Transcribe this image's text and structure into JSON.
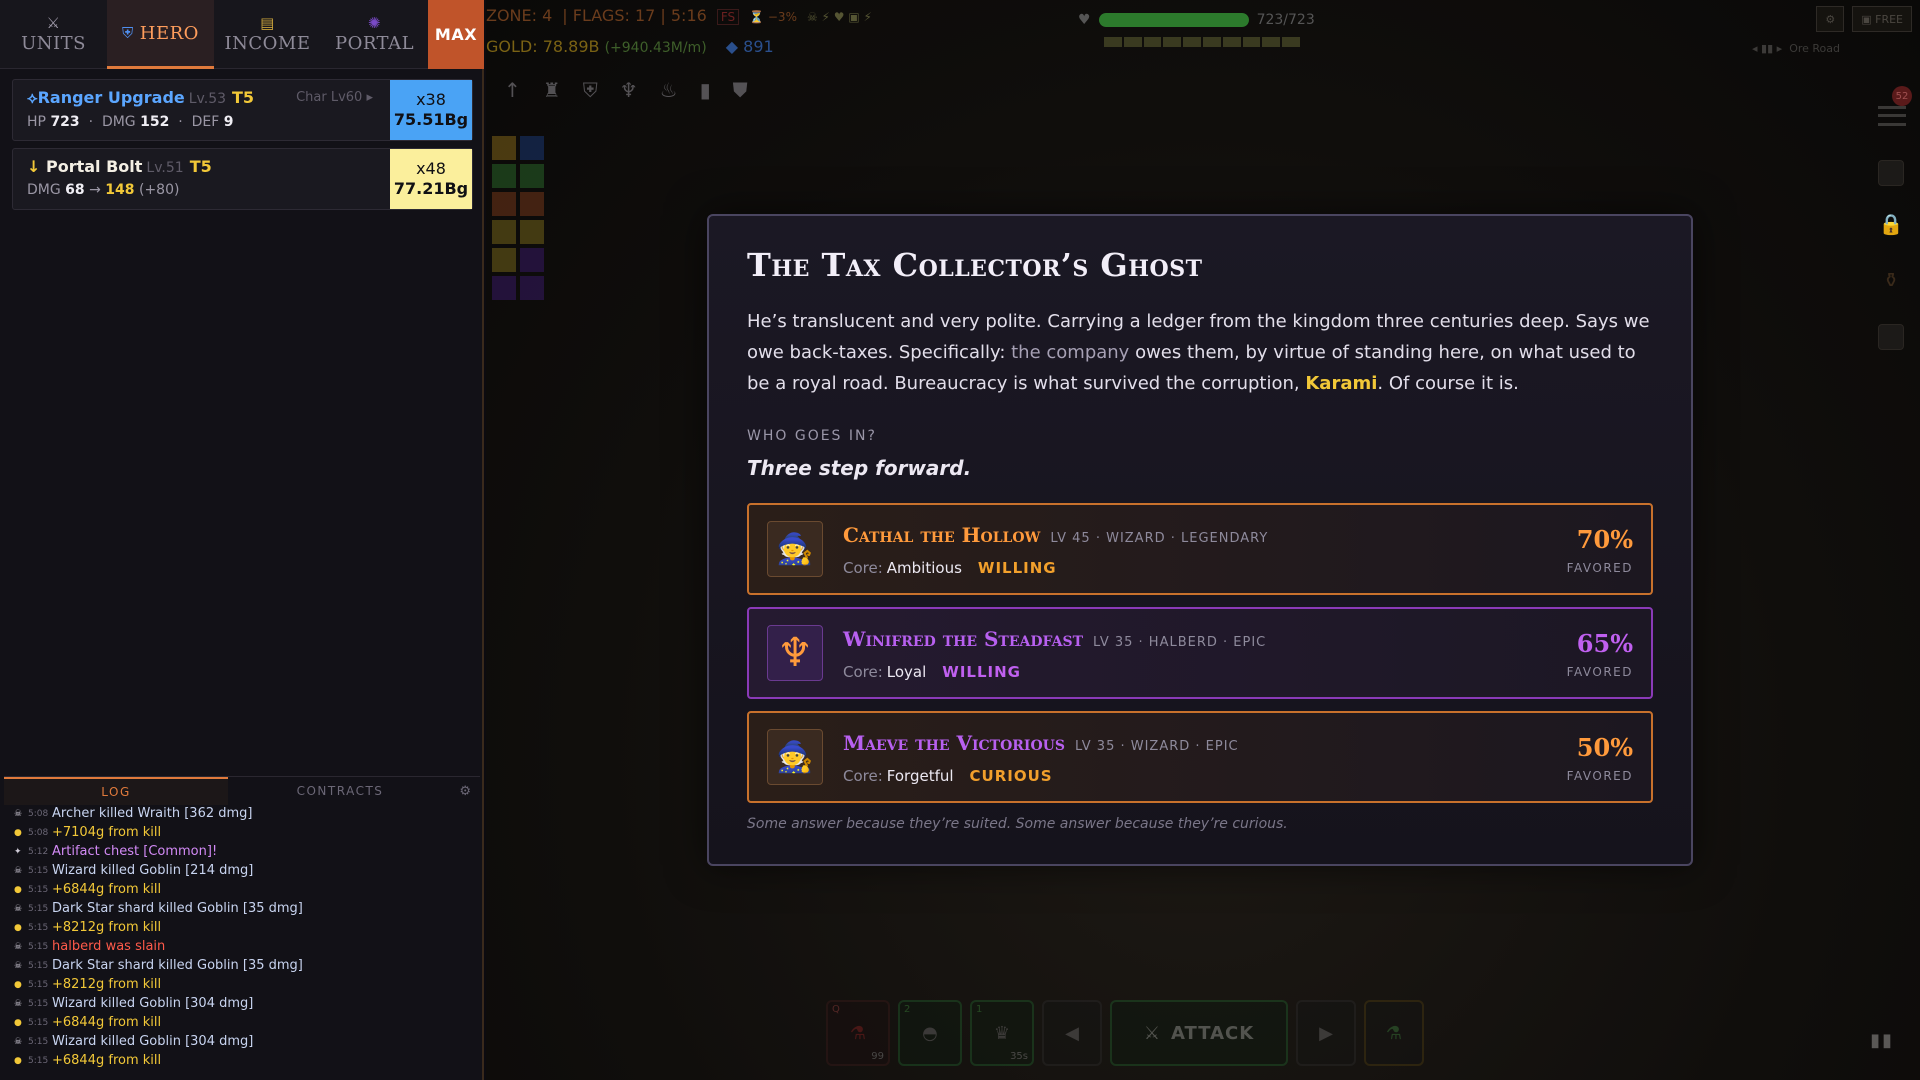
{
  "tabs": [
    {
      "label": "UNITS",
      "icon": "crossed-swords-icon"
    },
    {
      "label": "HERO",
      "icon": "shield-icon"
    },
    {
      "label": "INCOME",
      "icon": "coin-stack-icon"
    },
    {
      "label": "PORTAL",
      "icon": "portal-icon"
    },
    {
      "label": "MAX"
    }
  ],
  "upgrades": [
    {
      "name": "Ranger Upgrade",
      "level": "Lv.53",
      "tier": "T5",
      "char_level": "Char Lv60",
      "stats": {
        "hp_label": "HP",
        "hp": "723",
        "dmg_label": "DMG",
        "dmg": "152",
        "def_label": "DEF",
        "def": "9"
      },
      "qty": "x38",
      "cost": "75.51Bg"
    },
    {
      "name": "Portal Bolt",
      "level": "Lv.51",
      "tier": "T5",
      "stats": {
        "dmg_label": "DMG",
        "dmg_from": "68",
        "arrow": "→",
        "dmg_to": "148",
        "delta": "(+80)"
      },
      "qty": "x48",
      "cost": "77.21Bg"
    }
  ],
  "log_tabs": {
    "log": "LOG",
    "contracts": "CONTRACTS"
  },
  "log": [
    {
      "time": "5:08",
      "text": "Archer killed Wraith [362 dmg]",
      "kind": "kill"
    },
    {
      "time": "5:08",
      "text": "+7104g from kill",
      "kind": "gold"
    },
    {
      "time": "5:12",
      "text": "Artifact chest [Common]!",
      "kind": "loot"
    },
    {
      "time": "5:15",
      "text": "Wizard killed Goblin [214 dmg]",
      "kind": "kill"
    },
    {
      "time": "5:15",
      "text": "+6844g from kill",
      "kind": "gold"
    },
    {
      "time": "5:15",
      "text": "Dark Star shard killed Goblin [35 dmg]",
      "kind": "kill"
    },
    {
      "time": "5:15",
      "text": "+8212g from kill",
      "kind": "gold"
    },
    {
      "time": "5:15",
      "text": "halberd was slain",
      "kind": "dead"
    },
    {
      "time": "5:15",
      "text": "Dark Star shard killed Goblin [35 dmg]",
      "kind": "kill"
    },
    {
      "time": "5:15",
      "text": "+8212g from kill",
      "kind": "gold"
    },
    {
      "time": "5:15",
      "text": "Wizard killed Goblin [304 dmg]",
      "kind": "kill"
    },
    {
      "time": "5:15",
      "text": "+6844g from kill",
      "kind": "gold"
    },
    {
      "time": "5:15",
      "text": "Wizard killed Goblin [304 dmg]",
      "kind": "kill"
    },
    {
      "time": "5:15",
      "text": "+6844g from kill",
      "kind": "gold"
    }
  ],
  "hud": {
    "zone": "ZONE: 4",
    "flags": "| FLAGS: 17 | 5:16",
    "fs": "FS",
    "modifier": "⏳ −3%",
    "gold": "GOLD: 78.89B",
    "gold_rate": "(+940.43M/m)",
    "gems": "891",
    "hp_text": "723/723",
    "hp_fraction": 1.0,
    "free_label": "FREE",
    "area_name": "Ore Road"
  },
  "actions": {
    "potion_key": "Q",
    "potion_count": "99",
    "slot2_key": "2",
    "slot3_key": "1",
    "slot3_timer": "35s",
    "attack": "ATTACK"
  },
  "modal": {
    "title": "The Tax Collector’s Ghost",
    "body_1": "He’s translucent and very polite. Carrying a ledger from the kingdom three centuries deep. Says we owe back-taxes. Specifically: ",
    "body_company": "the company",
    "body_2": " owes them, by virtue of standing here, on what used to be a royal road. Bureaucracy is what survived the corruption, ",
    "body_name": "Karami",
    "body_3": ". Of course it is.",
    "question": "WHO GOES IN?",
    "answer": "Three step forward.",
    "candidates": [
      {
        "name": "Cathal the Hollow",
        "meta": "LV 45 · WIZARD · LEGENDARY",
        "core_label": "Core:",
        "core": "Ambitious",
        "mood": "WILLING",
        "pct": "70%",
        "status": "FAVORED",
        "avatar": "wizard-icon"
      },
      {
        "name": "Winifred the Steadfast",
        "meta": "LV 35 · HALBERD · EPIC",
        "core_label": "Core:",
        "core": "Loyal",
        "mood": "WILLING",
        "pct": "65%",
        "status": "FAVORED",
        "avatar": "trident-icon"
      },
      {
        "name": "Maeve the Victorious",
        "meta": "LV 35 · WIZARD · EPIC",
        "core_label": "Core:",
        "core": "Forgetful",
        "mood": "CURIOUS",
        "pct": "50%",
        "status": "FAVORED",
        "avatar": "wizard-icon"
      }
    ],
    "footer": "Some answer because they’re suited. Some answer because they’re curious."
  }
}
